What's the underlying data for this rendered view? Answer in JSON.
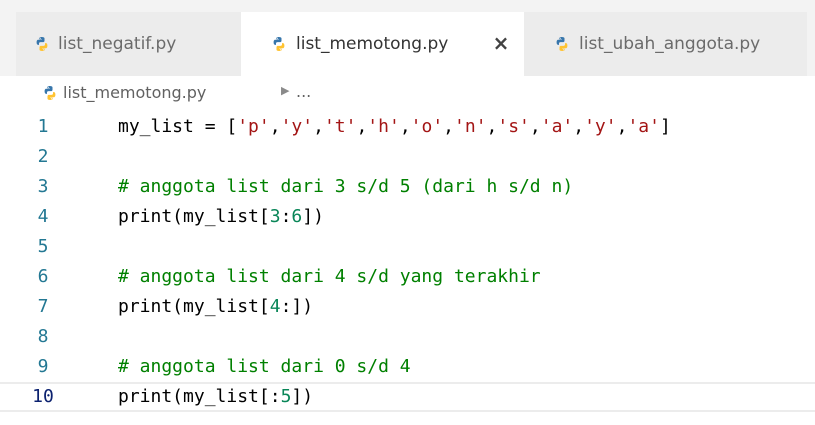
{
  "tabs": [
    {
      "label": "list_negatif.py",
      "active": false
    },
    {
      "label": "list_memotong.py",
      "active": true,
      "close_glyph": "×"
    },
    {
      "label": "list_ubah_anggota.py",
      "active": false
    }
  ],
  "breadcrumb": {
    "file": "list_memotong.py",
    "separator": "▶",
    "more": "..."
  },
  "editor": {
    "current_line": 10,
    "lines": [
      {
        "number": "1",
        "text": "my_list = ['p','y','t','h','o','n','s','a','y','a']"
      },
      {
        "number": "2",
        "text": ""
      },
      {
        "number": "3",
        "text": "# anggota list dari 3 s/d 5 (dari h s/d n)"
      },
      {
        "number": "4",
        "text": "print(my_list[3:6])"
      },
      {
        "number": "5",
        "text": ""
      },
      {
        "number": "6",
        "text": "# anggota list dari 4 s/d yang terakhir"
      },
      {
        "number": "7",
        "text": "print(my_list[4:])"
      },
      {
        "number": "8",
        "text": ""
      },
      {
        "number": "9",
        "text": "# anggota list dari 0 s/d 4"
      },
      {
        "number": "10",
        "text": "print(my_list[:5])"
      }
    ]
  },
  "colors": {
    "tab_bar_bg": "#f3f3f3",
    "active_tab_bg": "#ffffff",
    "line_number": "#237893",
    "string": "#a31515",
    "number": "#098658",
    "comment": "#008000",
    "python_icon_blue": "#3776ab",
    "python_icon_yellow": "#ffd43b"
  },
  "icons": {
    "tab": "python-file-icon",
    "breadcrumb": "python-file-icon",
    "close": "close-icon"
  }
}
